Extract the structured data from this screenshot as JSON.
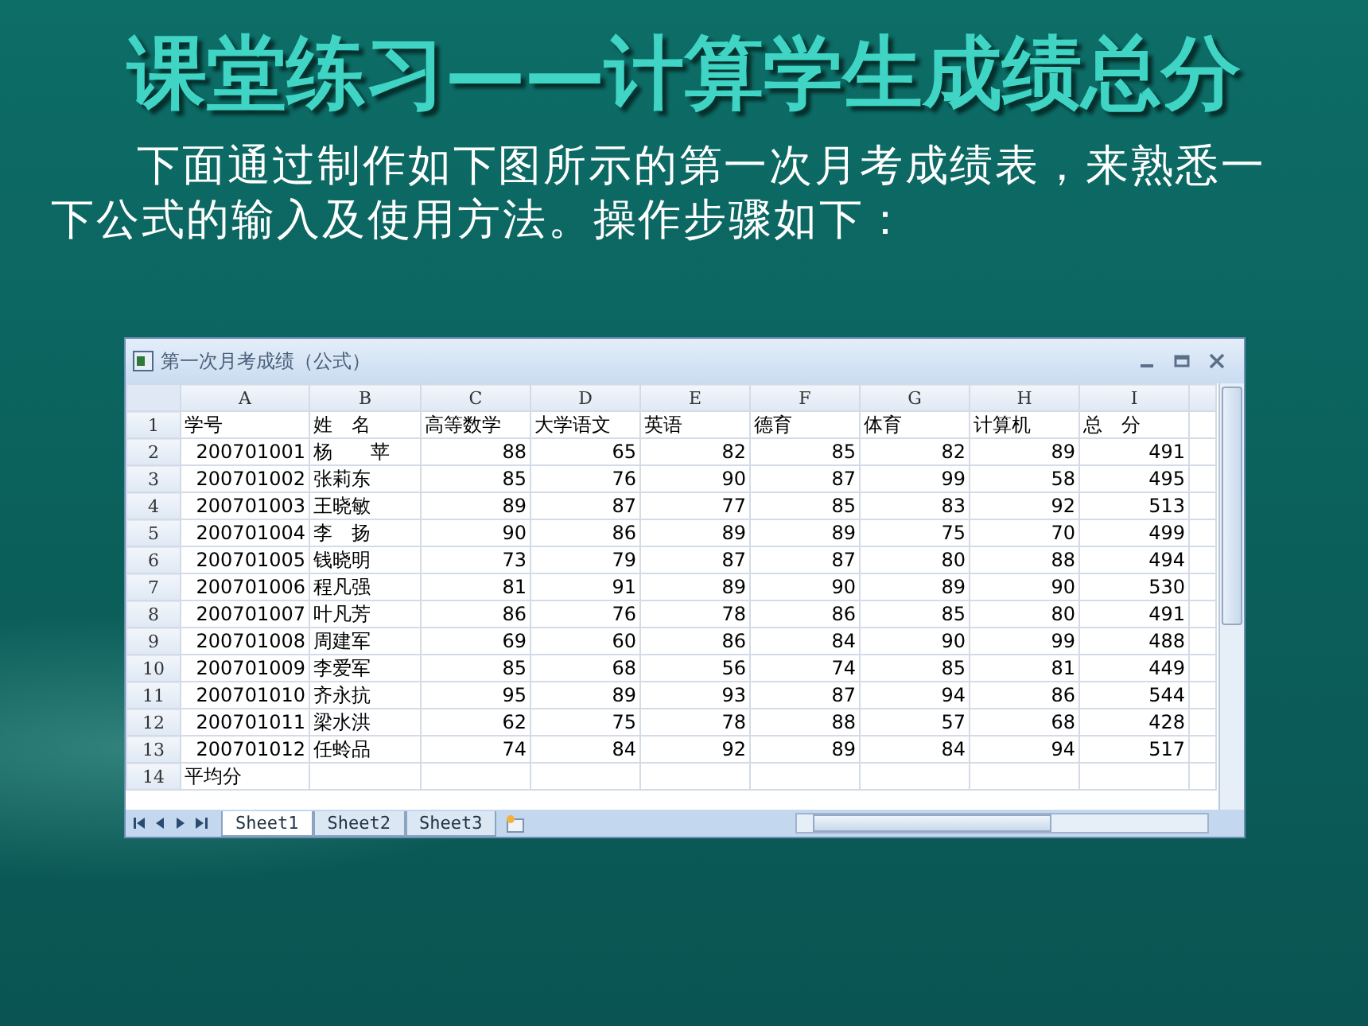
{
  "title": "课堂练习——计算学生成绩总分",
  "intro": "下面通过制作如下图所示的第一次月考成绩表，来熟悉一下公式的输入及使用方法。操作步骤如下：",
  "spreadsheet": {
    "window_title": "第一次月考成绩（公式）",
    "columns": [
      {
        "letter": "A",
        "kind": "number"
      },
      {
        "letter": "B",
        "kind": "text"
      },
      {
        "letter": "C",
        "kind": "number"
      },
      {
        "letter": "D",
        "kind": "number"
      },
      {
        "letter": "E",
        "kind": "number"
      },
      {
        "letter": "F",
        "kind": "number"
      },
      {
        "letter": "G",
        "kind": "number"
      },
      {
        "letter": "H",
        "kind": "number"
      },
      {
        "letter": "I",
        "kind": "number"
      }
    ],
    "rows": [
      {
        "number": "1",
        "kind": "header",
        "cells": [
          "学号",
          "姓　名",
          "高等数学",
          "大学语文",
          "英语",
          "德育",
          "体育",
          "计算机",
          "总　分"
        ]
      },
      {
        "number": "2",
        "kind": "data",
        "cells": [
          "200701001",
          "杨　　苹",
          "88",
          "65",
          "82",
          "85",
          "82",
          "89",
          "491"
        ]
      },
      {
        "number": "3",
        "kind": "data",
        "cells": [
          "200701002",
          "张莉东",
          "85",
          "76",
          "90",
          "87",
          "99",
          "58",
          "495"
        ]
      },
      {
        "number": "4",
        "kind": "data",
        "cells": [
          "200701003",
          "王晓敏",
          "89",
          "87",
          "77",
          "85",
          "83",
          "92",
          "513"
        ]
      },
      {
        "number": "5",
        "kind": "data",
        "cells": [
          "200701004",
          "李　扬",
          "90",
          "86",
          "89",
          "89",
          "75",
          "70",
          "499"
        ]
      },
      {
        "number": "6",
        "kind": "data",
        "cells": [
          "200701005",
          "钱晓明",
          "73",
          "79",
          "87",
          "87",
          "80",
          "88",
          "494"
        ]
      },
      {
        "number": "7",
        "kind": "data",
        "cells": [
          "200701006",
          "程凡强",
          "81",
          "91",
          "89",
          "90",
          "89",
          "90",
          "530"
        ]
      },
      {
        "number": "8",
        "kind": "data",
        "cells": [
          "200701007",
          "叶凡芳",
          "86",
          "76",
          "78",
          "86",
          "85",
          "80",
          "491"
        ]
      },
      {
        "number": "9",
        "kind": "data",
        "cells": [
          "200701008",
          "周建军",
          "69",
          "60",
          "86",
          "84",
          "90",
          "99",
          "488"
        ]
      },
      {
        "number": "10",
        "kind": "data",
        "cells": [
          "200701009",
          "李爱军",
          "85",
          "68",
          "56",
          "74",
          "85",
          "81",
          "449"
        ]
      },
      {
        "number": "11",
        "kind": "data",
        "cells": [
          "200701010",
          "齐永抗",
          "95",
          "89",
          "93",
          "87",
          "94",
          "86",
          "544"
        ]
      },
      {
        "number": "12",
        "kind": "data",
        "cells": [
          "200701011",
          "梁水洪",
          "62",
          "75",
          "78",
          "88",
          "57",
          "68",
          "428"
        ]
      },
      {
        "number": "13",
        "kind": "data",
        "cells": [
          "200701012",
          "任蛉品",
          "74",
          "84",
          "92",
          "89",
          "84",
          "94",
          "517"
        ]
      },
      {
        "number": "14",
        "kind": "header",
        "cells": [
          "平均分",
          "",
          "",
          "",
          "",
          "",
          "",
          "",
          ""
        ]
      }
    ],
    "sheet_tabs": [
      {
        "label": "Sheet1",
        "selected": true
      },
      {
        "label": "Sheet2",
        "selected": false
      },
      {
        "label": "Sheet3",
        "selected": false
      }
    ]
  }
}
